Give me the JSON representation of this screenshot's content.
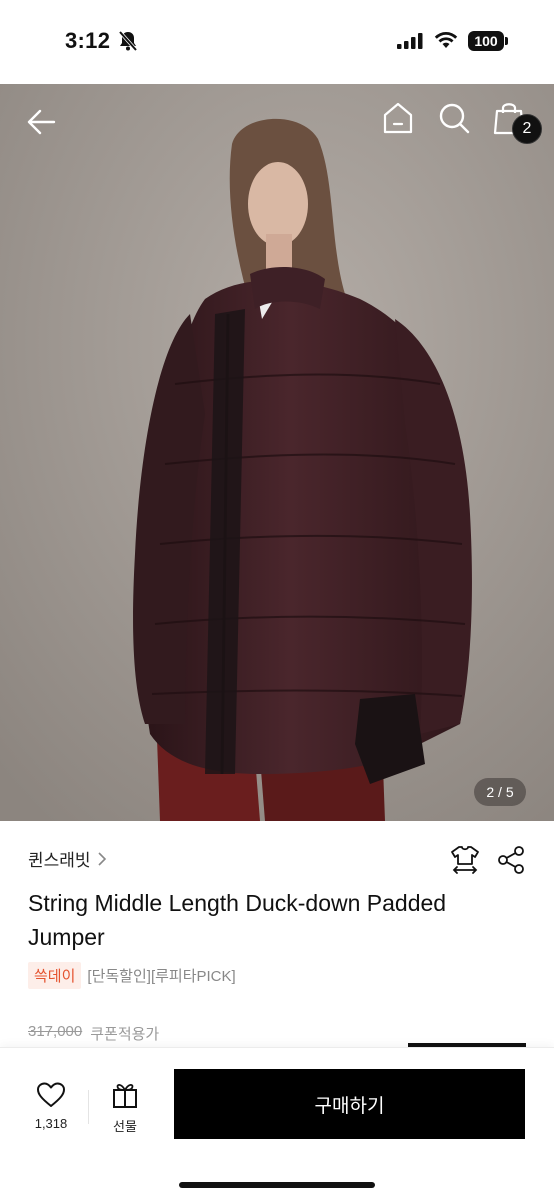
{
  "status_bar": {
    "time": "3:12",
    "battery": "100"
  },
  "header": {
    "cart_count": "2"
  },
  "hero": {
    "page_indicator": "2 / 5"
  },
  "product": {
    "brand": "퀸스래빗",
    "title": "String Middle Length Duck-down Padded Jumper",
    "sale_badge": "쓱데이",
    "tags": "[단독할인][루피타PICK]",
    "original_price": "317,000",
    "coupon_label": "쿠폰적용가"
  },
  "bottom_bar": {
    "like_count": "1,318",
    "gift_label": "선물",
    "buy_label": "구매하기"
  },
  "icons": [
    "bell-slash-icon",
    "signal-icon",
    "wifi-icon",
    "battery-icon",
    "back-arrow-icon",
    "home-icon",
    "search-icon",
    "shopping-bag-icon",
    "chevron-right-icon",
    "size-guide-icon",
    "share-icon",
    "heart-icon",
    "gift-icon"
  ],
  "colors": {
    "accent_sale": "#e5532f",
    "buy_button": "#000000",
    "jacket": "#3b1e22"
  }
}
